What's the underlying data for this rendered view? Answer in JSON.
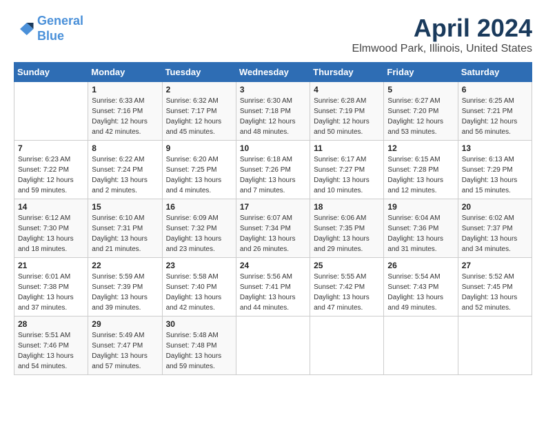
{
  "logo": {
    "line1": "General",
    "line2": "Blue"
  },
  "title": "April 2024",
  "subtitle": "Elmwood Park, Illinois, United States",
  "days_of_week": [
    "Sunday",
    "Monday",
    "Tuesday",
    "Wednesday",
    "Thursday",
    "Friday",
    "Saturday"
  ],
  "weeks": [
    [
      {
        "day": "",
        "sunrise": "",
        "sunset": "",
        "daylight": ""
      },
      {
        "day": "1",
        "sunrise": "Sunrise: 6:33 AM",
        "sunset": "Sunset: 7:16 PM",
        "daylight": "Daylight: 12 hours and 42 minutes."
      },
      {
        "day": "2",
        "sunrise": "Sunrise: 6:32 AM",
        "sunset": "Sunset: 7:17 PM",
        "daylight": "Daylight: 12 hours and 45 minutes."
      },
      {
        "day": "3",
        "sunrise": "Sunrise: 6:30 AM",
        "sunset": "Sunset: 7:18 PM",
        "daylight": "Daylight: 12 hours and 48 minutes."
      },
      {
        "day": "4",
        "sunrise": "Sunrise: 6:28 AM",
        "sunset": "Sunset: 7:19 PM",
        "daylight": "Daylight: 12 hours and 50 minutes."
      },
      {
        "day": "5",
        "sunrise": "Sunrise: 6:27 AM",
        "sunset": "Sunset: 7:20 PM",
        "daylight": "Daylight: 12 hours and 53 minutes."
      },
      {
        "day": "6",
        "sunrise": "Sunrise: 6:25 AM",
        "sunset": "Sunset: 7:21 PM",
        "daylight": "Daylight: 12 hours and 56 minutes."
      }
    ],
    [
      {
        "day": "7",
        "sunrise": "Sunrise: 6:23 AM",
        "sunset": "Sunset: 7:22 PM",
        "daylight": "Daylight: 12 hours and 59 minutes."
      },
      {
        "day": "8",
        "sunrise": "Sunrise: 6:22 AM",
        "sunset": "Sunset: 7:24 PM",
        "daylight": "Daylight: 13 hours and 2 minutes."
      },
      {
        "day": "9",
        "sunrise": "Sunrise: 6:20 AM",
        "sunset": "Sunset: 7:25 PM",
        "daylight": "Daylight: 13 hours and 4 minutes."
      },
      {
        "day": "10",
        "sunrise": "Sunrise: 6:18 AM",
        "sunset": "Sunset: 7:26 PM",
        "daylight": "Daylight: 13 hours and 7 minutes."
      },
      {
        "day": "11",
        "sunrise": "Sunrise: 6:17 AM",
        "sunset": "Sunset: 7:27 PM",
        "daylight": "Daylight: 13 hours and 10 minutes."
      },
      {
        "day": "12",
        "sunrise": "Sunrise: 6:15 AM",
        "sunset": "Sunset: 7:28 PM",
        "daylight": "Daylight: 13 hours and 12 minutes."
      },
      {
        "day": "13",
        "sunrise": "Sunrise: 6:13 AM",
        "sunset": "Sunset: 7:29 PM",
        "daylight": "Daylight: 13 hours and 15 minutes."
      }
    ],
    [
      {
        "day": "14",
        "sunrise": "Sunrise: 6:12 AM",
        "sunset": "Sunset: 7:30 PM",
        "daylight": "Daylight: 13 hours and 18 minutes."
      },
      {
        "day": "15",
        "sunrise": "Sunrise: 6:10 AM",
        "sunset": "Sunset: 7:31 PM",
        "daylight": "Daylight: 13 hours and 21 minutes."
      },
      {
        "day": "16",
        "sunrise": "Sunrise: 6:09 AM",
        "sunset": "Sunset: 7:32 PM",
        "daylight": "Daylight: 13 hours and 23 minutes."
      },
      {
        "day": "17",
        "sunrise": "Sunrise: 6:07 AM",
        "sunset": "Sunset: 7:34 PM",
        "daylight": "Daylight: 13 hours and 26 minutes."
      },
      {
        "day": "18",
        "sunrise": "Sunrise: 6:06 AM",
        "sunset": "Sunset: 7:35 PM",
        "daylight": "Daylight: 13 hours and 29 minutes."
      },
      {
        "day": "19",
        "sunrise": "Sunrise: 6:04 AM",
        "sunset": "Sunset: 7:36 PM",
        "daylight": "Daylight: 13 hours and 31 minutes."
      },
      {
        "day": "20",
        "sunrise": "Sunrise: 6:02 AM",
        "sunset": "Sunset: 7:37 PM",
        "daylight": "Daylight: 13 hours and 34 minutes."
      }
    ],
    [
      {
        "day": "21",
        "sunrise": "Sunrise: 6:01 AM",
        "sunset": "Sunset: 7:38 PM",
        "daylight": "Daylight: 13 hours and 37 minutes."
      },
      {
        "day": "22",
        "sunrise": "Sunrise: 5:59 AM",
        "sunset": "Sunset: 7:39 PM",
        "daylight": "Daylight: 13 hours and 39 minutes."
      },
      {
        "day": "23",
        "sunrise": "Sunrise: 5:58 AM",
        "sunset": "Sunset: 7:40 PM",
        "daylight": "Daylight: 13 hours and 42 minutes."
      },
      {
        "day": "24",
        "sunrise": "Sunrise: 5:56 AM",
        "sunset": "Sunset: 7:41 PM",
        "daylight": "Daylight: 13 hours and 44 minutes."
      },
      {
        "day": "25",
        "sunrise": "Sunrise: 5:55 AM",
        "sunset": "Sunset: 7:42 PM",
        "daylight": "Daylight: 13 hours and 47 minutes."
      },
      {
        "day": "26",
        "sunrise": "Sunrise: 5:54 AM",
        "sunset": "Sunset: 7:43 PM",
        "daylight": "Daylight: 13 hours and 49 minutes."
      },
      {
        "day": "27",
        "sunrise": "Sunrise: 5:52 AM",
        "sunset": "Sunset: 7:45 PM",
        "daylight": "Daylight: 13 hours and 52 minutes."
      }
    ],
    [
      {
        "day": "28",
        "sunrise": "Sunrise: 5:51 AM",
        "sunset": "Sunset: 7:46 PM",
        "daylight": "Daylight: 13 hours and 54 minutes."
      },
      {
        "day": "29",
        "sunrise": "Sunrise: 5:49 AM",
        "sunset": "Sunset: 7:47 PM",
        "daylight": "Daylight: 13 hours and 57 minutes."
      },
      {
        "day": "30",
        "sunrise": "Sunrise: 5:48 AM",
        "sunset": "Sunset: 7:48 PM",
        "daylight": "Daylight: 13 hours and 59 minutes."
      },
      {
        "day": "",
        "sunrise": "",
        "sunset": "",
        "daylight": ""
      },
      {
        "day": "",
        "sunrise": "",
        "sunset": "",
        "daylight": ""
      },
      {
        "day": "",
        "sunrise": "",
        "sunset": "",
        "daylight": ""
      },
      {
        "day": "",
        "sunrise": "",
        "sunset": "",
        "daylight": ""
      }
    ]
  ]
}
